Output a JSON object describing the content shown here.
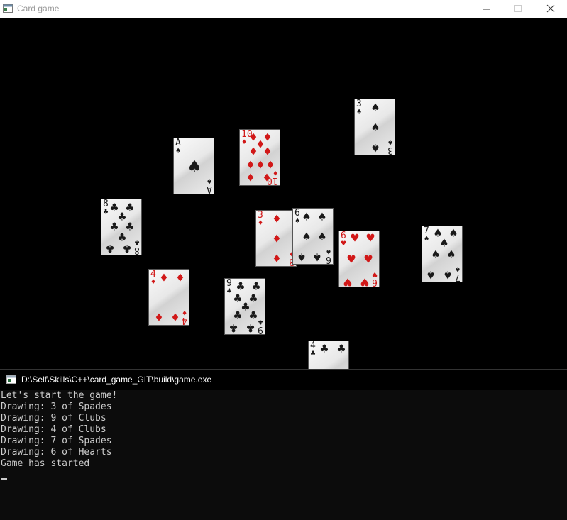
{
  "window": {
    "title": "Card game",
    "minimize_icon": "minimize-icon",
    "maximize_icon": "maximize-icon",
    "close_icon": "close-icon"
  },
  "game": {
    "background": "#000000",
    "cards": [
      {
        "id": "card-3-spades",
        "rank": "3",
        "suit": "♠",
        "color": "black"
      },
      {
        "id": "card-a-spades",
        "rank": "A",
        "suit": "♠",
        "color": "black"
      },
      {
        "id": "card-10-diamonds",
        "rank": "10",
        "suit": "♦",
        "color": "red"
      },
      {
        "id": "card-8-clubs",
        "rank": "8",
        "suit": "♣",
        "color": "black"
      },
      {
        "id": "card-3-diamonds",
        "rank": "3",
        "suit": "♦",
        "color": "red"
      },
      {
        "id": "card-6-spades",
        "rank": "6",
        "suit": "♠",
        "color": "black"
      },
      {
        "id": "card-6-hearts",
        "rank": "6",
        "suit": "♥",
        "color": "red"
      },
      {
        "id": "card-7-spades",
        "rank": "7",
        "suit": "♠",
        "color": "black"
      },
      {
        "id": "card-4-diamonds",
        "rank": "4",
        "suit": "♦",
        "color": "red"
      },
      {
        "id": "card-9-clubs",
        "rank": "9",
        "suit": "♣",
        "color": "black"
      },
      {
        "id": "card-4-clubs",
        "rank": "4",
        "suit": "♣",
        "color": "black"
      }
    ]
  },
  "console": {
    "title": "D:\\Self\\Skills\\C++\\card_game_GIT\\build\\game.exe",
    "lines": [
      "Let's start the game!",
      "Drawing: 3 of Spades",
      "Drawing: 9 of Clubs",
      "Drawing: 4 of Clubs",
      "Drawing: 7 of Spades",
      "Drawing: 6 of Hearts",
      "Game has started"
    ],
    "text_color": "#cccccc",
    "background": "#0c0c0c"
  }
}
